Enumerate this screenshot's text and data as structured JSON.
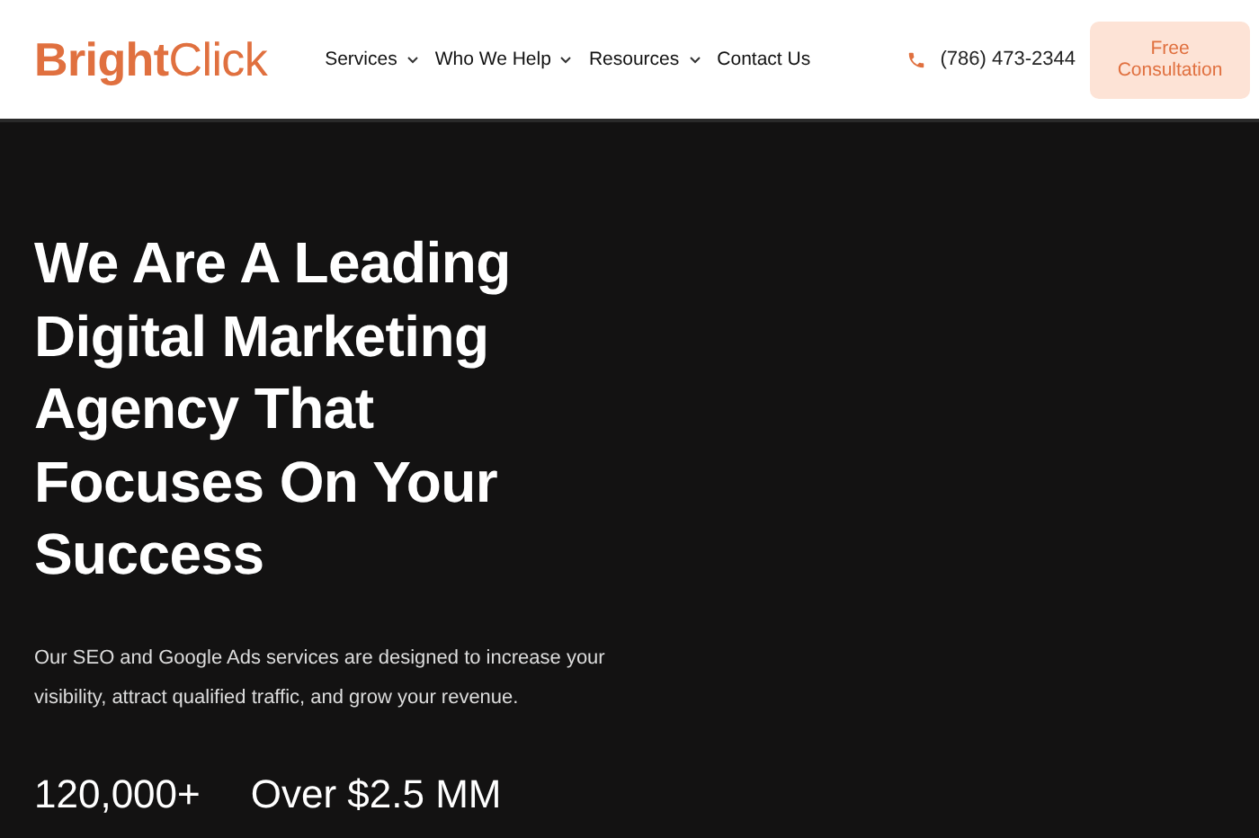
{
  "header": {
    "logo": "**Bright**Click",
    "nav": [
      {
        "label": "Services",
        "has_menu": true
      },
      {
        "label": "Who We Help",
        "has_menu": true
      },
      {
        "label": "Resources",
        "has_menu": true
      },
      {
        "label": "Contact Us",
        "has_menu": false
      }
    ],
    "phone": "(786) 473-2344",
    "cta": "Free Consultation"
  },
  "hero": {
    "heading": "We Are A Leading Digital Marketing Agency That Focuses On Your Success",
    "description": "Our SEO and Google Ads services are designed to increase your visibility, attract qualified traffic, and grow your revenue.",
    "stats": [
      "120,000+",
      "Over $2.5 MM"
    ]
  }
}
